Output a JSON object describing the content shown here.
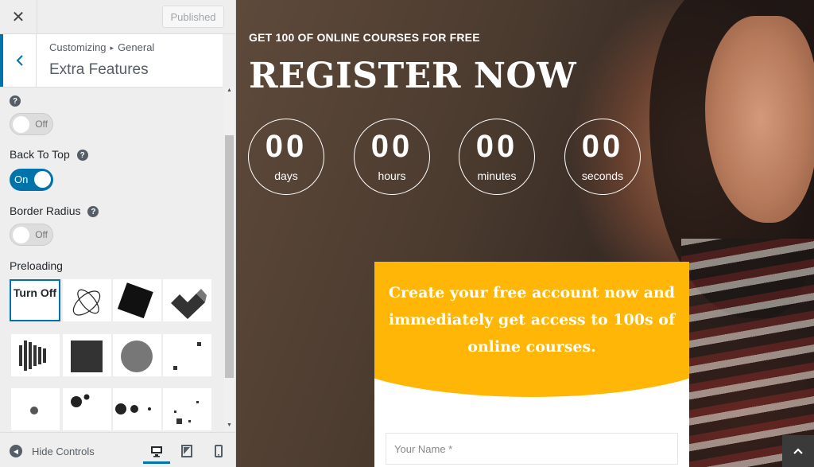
{
  "panel": {
    "published_label": "Published",
    "breadcrumb_root": "Customizing",
    "breadcrumb_current": "General",
    "section_title": "Extra Features",
    "help_glyph": "?",
    "controls": [
      {
        "label": "",
        "state": "Off"
      },
      {
        "label": "Back To Top",
        "state": "On"
      },
      {
        "label": "Border Radius",
        "state": "Off"
      }
    ],
    "preloading_label": "Preloading",
    "turn_off_label": "Turn Off",
    "hide_controls_label": "Hide Controls"
  },
  "preview": {
    "pre_title": "GET 100 OF ONLINE COURSES FOR FREE",
    "title": "REGISTER NOW",
    "countdown": [
      {
        "value": "00",
        "unit": "days"
      },
      {
        "value": "00",
        "unit": "hours"
      },
      {
        "value": "00",
        "unit": "minutes"
      },
      {
        "value": "00",
        "unit": "seconds"
      }
    ],
    "card_text": "Create your free account now and immediately get access to 100s of online courses.",
    "name_placeholder": "Your Name *"
  },
  "colors": {
    "accent": "#0073aa",
    "card_yellow": "#ffb606",
    "panel_bg": "#eeeeee"
  }
}
